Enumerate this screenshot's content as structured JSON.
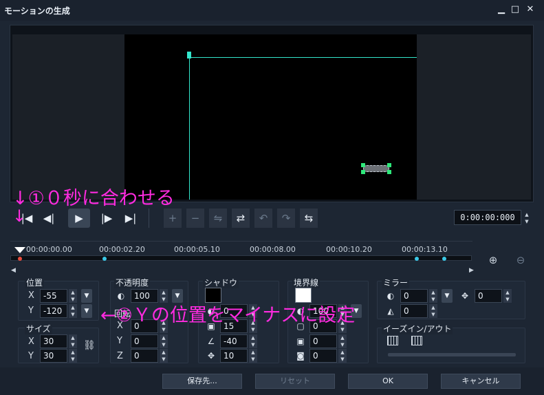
{
  "window": {
    "title": "モーションの生成",
    "minimize": "▁",
    "maximize": "□",
    "close": "✕"
  },
  "playback": {
    "timecode": "0:00:00:000",
    "btn_home": "|◀",
    "btn_prev": "◀|",
    "btn_play": "▶",
    "btn_next": "|▶",
    "btn_end": "▶|",
    "kf_add": "+",
    "kf_remove": "−",
    "kf_reverse": "⇄",
    "kf_prev": "↶",
    "kf_next": "↷",
    "kf_swap": "⇆",
    "kf_copy": "⇋"
  },
  "ruler": {
    "labels": [
      "00:00:00.00",
      "00:00:02.20",
      "00:00:05.10",
      "00:00:08.00",
      "00:00:10.20",
      "00:00:13.10"
    ]
  },
  "position": {
    "label": "位置",
    "x_label": "X",
    "x": "-55",
    "y_label": "Y",
    "y": "-120"
  },
  "size": {
    "label": "サイズ",
    "x_label": "X",
    "x": "30",
    "y_label": "Y",
    "y": "30"
  },
  "opacity": {
    "label": "不透明度",
    "value": "100"
  },
  "rotation": {
    "label": "回転",
    "x_label": "X",
    "x": "0",
    "y_label": "Y",
    "y": "0",
    "z_label": "Z",
    "z": "0"
  },
  "shadow": {
    "label": "シャドウ",
    "v1": "0",
    "v2": "15",
    "v3": "-40",
    "v4": "10"
  },
  "border": {
    "label": "境界線",
    "v1": "100",
    "v2": "0",
    "v3": "0",
    "v4": "0"
  },
  "mirror": {
    "label": "ミラー",
    "v1": "0",
    "v2": "0",
    "v3": "0"
  },
  "ease": {
    "label": "イーズイン/アウト"
  },
  "buttons": {
    "save": "保存先...",
    "reset": "リセット",
    "ok": "OK",
    "cancel": "キャンセル"
  },
  "annotations": {
    "arrow1": "↓",
    "note1": "↓①０秒に合わせる",
    "note2": "←②Ｙの位置をマイナスに設定"
  },
  "colors": {
    "accent_cyan": "#33e6cc",
    "annotation": "#ff2be0",
    "handle_green": "#2ee87a",
    "keyframe_red": "#e84c3d"
  }
}
